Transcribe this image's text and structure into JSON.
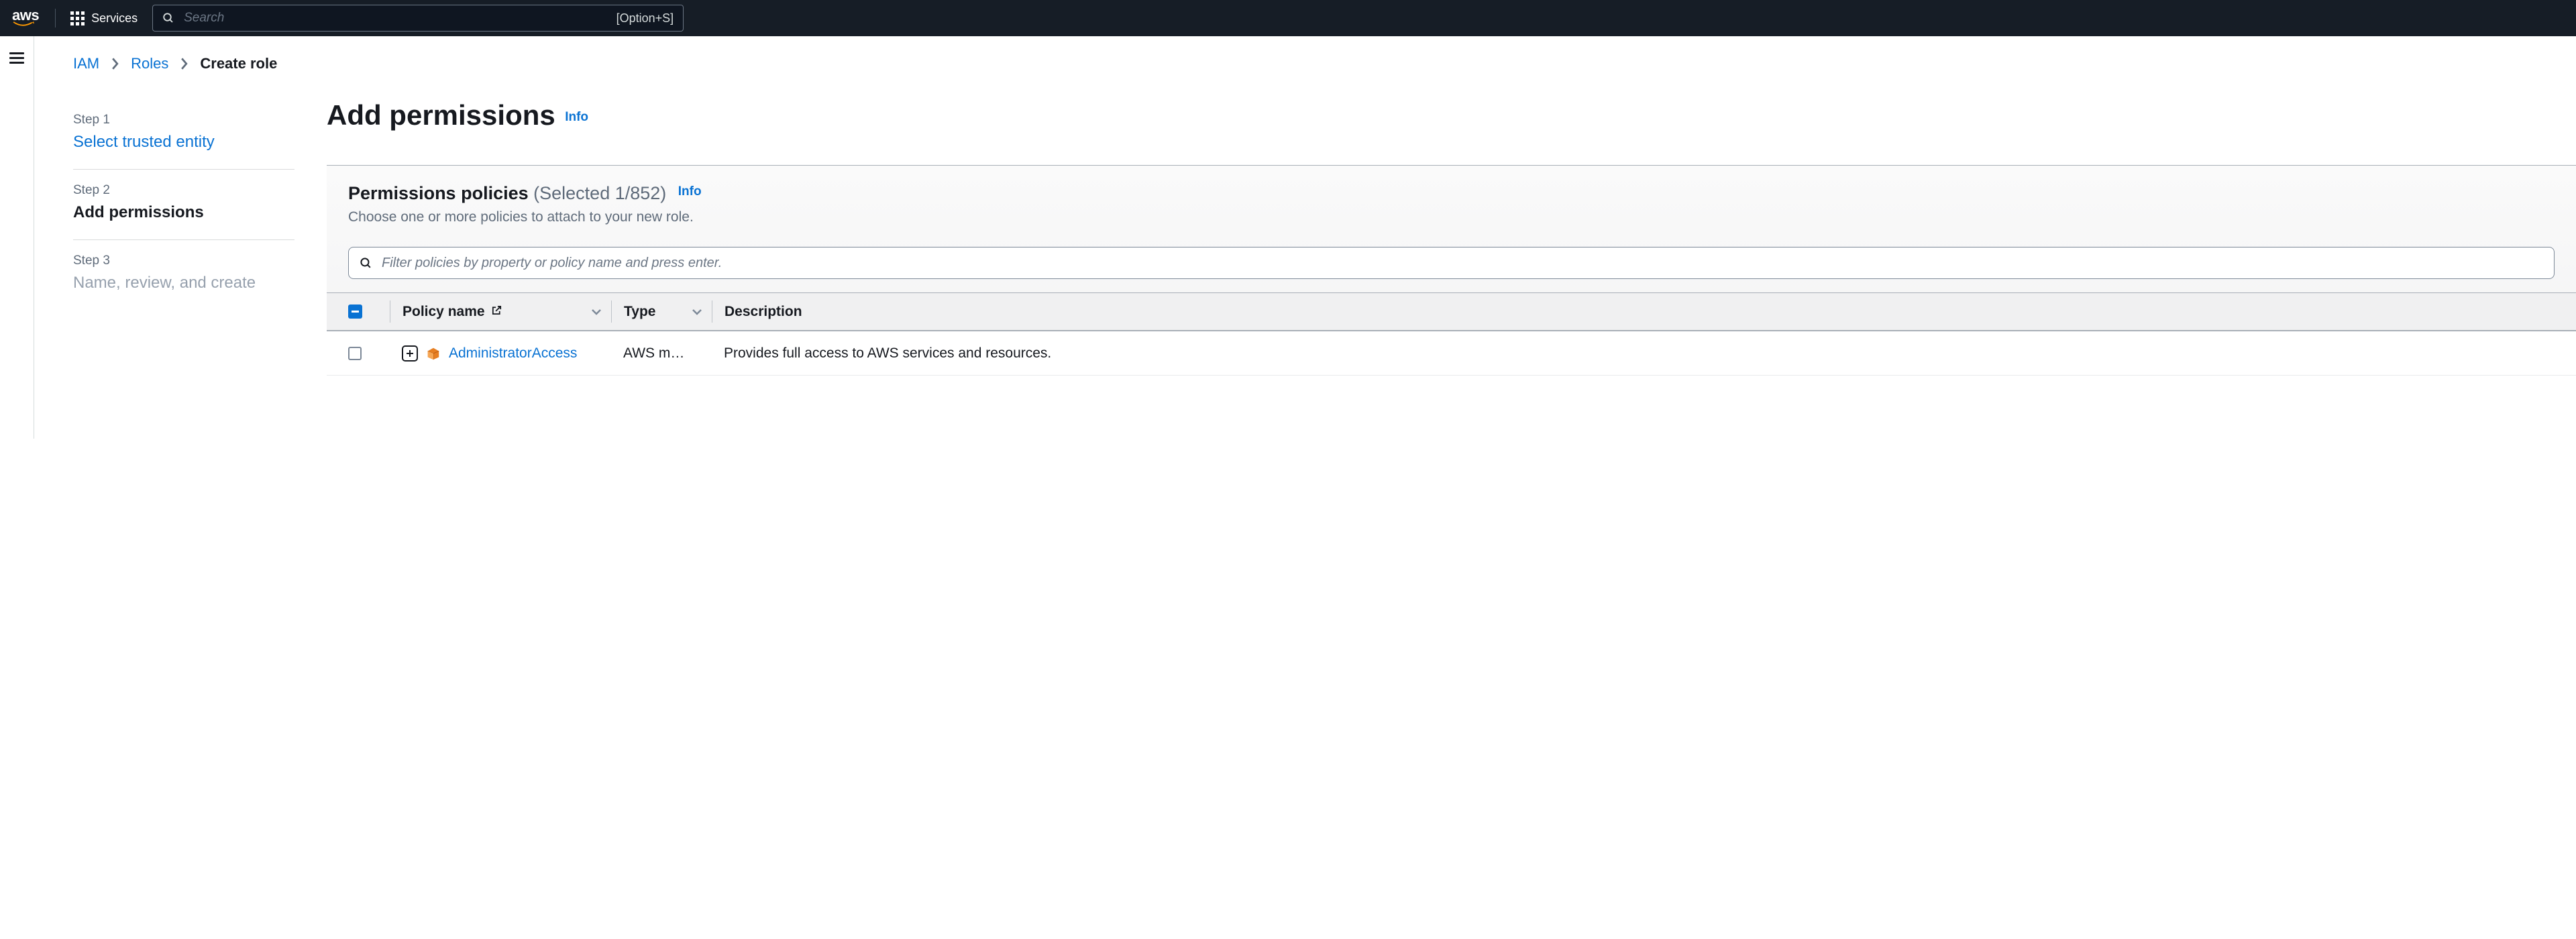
{
  "topnav": {
    "logo_text": "aws",
    "services_label": "Services",
    "search_placeholder": "Search",
    "search_shortcut": "[Option+S]"
  },
  "breadcrumb": {
    "items": [
      "IAM",
      "Roles"
    ],
    "current": "Create role"
  },
  "stepper": {
    "steps": [
      {
        "label": "Step 1",
        "title": "Select trusted entity"
      },
      {
        "label": "Step 2",
        "title": "Add permissions"
      },
      {
        "label": "Step 3",
        "title": "Name, review, and create"
      }
    ]
  },
  "main": {
    "heading": "Add permissions",
    "info_label": "Info"
  },
  "panel": {
    "title": "Permissions policies",
    "selected_text": "(Selected 1/852)",
    "info_label": "Info",
    "subtitle": "Choose one or more policies to attach to your new role.",
    "filter_placeholder": "Filter policies by property or policy name and press enter."
  },
  "table": {
    "headers": {
      "policy_name": "Policy name",
      "type": "Type",
      "description": "Description"
    },
    "rows": [
      {
        "name": "AdministratorAccess",
        "type": "AWS m…",
        "description": "Provides full access to AWS services and resources."
      }
    ]
  }
}
